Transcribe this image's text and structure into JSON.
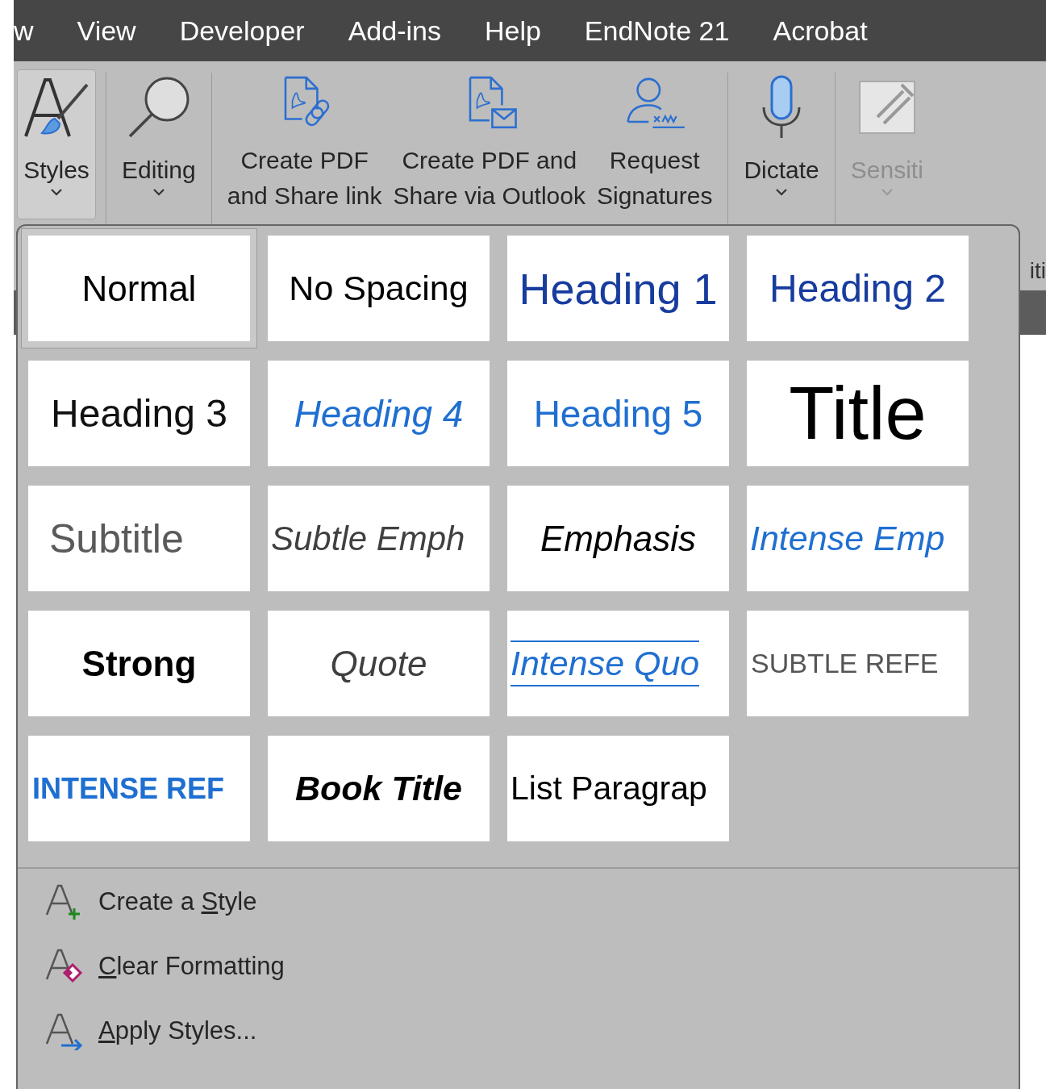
{
  "menu_tabs": [
    "w",
    "View",
    "Developer",
    "Add-ins",
    "Help",
    "EndNote 21",
    "Acrobat"
  ],
  "ribbon": {
    "groups": [
      {
        "buttons": [
          {
            "kind": "styles",
            "lines": [
              "Styles"
            ],
            "dropdown": true,
            "pressed": true,
            "disabled": false
          }
        ]
      },
      {
        "buttons": [
          {
            "kind": "search",
            "lines": [
              "Editing"
            ],
            "dropdown": true,
            "pressed": false,
            "disabled": false
          }
        ]
      },
      {
        "buttons": [
          {
            "kind": "pdf-link",
            "lines": [
              "Create PDF",
              "and Share link"
            ],
            "dropdown": false,
            "pressed": false,
            "disabled": false
          },
          {
            "kind": "pdf-mail",
            "lines": [
              "Create PDF and",
              "Share via Outlook"
            ],
            "dropdown": false,
            "pressed": false,
            "disabled": false
          },
          {
            "kind": "signature",
            "lines": [
              "Request",
              "Signatures"
            ],
            "dropdown": false,
            "pressed": false,
            "disabled": false
          }
        ]
      },
      {
        "buttons": [
          {
            "kind": "mic",
            "lines": [
              "Dictate"
            ],
            "dropdown": true,
            "pressed": false,
            "disabled": false
          }
        ]
      },
      {
        "buttons": [
          {
            "kind": "sensitivity",
            "lines": [
              "Sensiti"
            ],
            "dropdown": true,
            "pressed": false,
            "disabled": true
          }
        ]
      }
    ]
  },
  "background_text": "iti",
  "styles_gallery": {
    "tiles": [
      {
        "label": "Normal",
        "kind": "normal",
        "selected": true
      },
      {
        "label": "No Spacing",
        "kind": "no-spacing",
        "selected": false
      },
      {
        "label": "Heading 1",
        "kind": "heading1",
        "selected": false
      },
      {
        "label": "Heading 2",
        "kind": "heading2",
        "selected": false
      },
      {
        "label": "Heading 3",
        "kind": "heading3",
        "selected": false
      },
      {
        "label": "Heading 4",
        "kind": "heading4",
        "selected": false
      },
      {
        "label": "Heading 5",
        "kind": "heading5",
        "selected": false
      },
      {
        "label": "Title",
        "kind": "title",
        "selected": false
      },
      {
        "label": "Subtitle",
        "kind": "subtitle",
        "selected": false
      },
      {
        "label": "Subtle Emph",
        "kind": "subtle-emphasis",
        "selected": false
      },
      {
        "label": "Emphasis",
        "kind": "emphasis",
        "selected": false
      },
      {
        "label": "Intense Emp",
        "kind": "intense-emphasis",
        "selected": false
      },
      {
        "label": "Strong",
        "kind": "strong",
        "selected": false
      },
      {
        "label": "Quote",
        "kind": "quote",
        "selected": false
      },
      {
        "label": "Intense Quo",
        "kind": "intense-quote",
        "selected": false
      },
      {
        "label": "SUBTLE REFE",
        "kind": "subtle-reference",
        "selected": false
      },
      {
        "label": "INTENSE REF",
        "kind": "intense-reference",
        "selected": false
      },
      {
        "label": "Book Title",
        "kind": "book-title",
        "selected": false
      },
      {
        "label": "List Paragrap",
        "kind": "list-paragraph",
        "selected": false
      }
    ],
    "commands": [
      {
        "kind": "create",
        "pre": "Create a ",
        "key": "S",
        "post": "tyle"
      },
      {
        "kind": "clear",
        "key": "C",
        "post": "lear Formatting"
      },
      {
        "kind": "apply",
        "key": "A",
        "post": "pply Styles..."
      }
    ]
  }
}
